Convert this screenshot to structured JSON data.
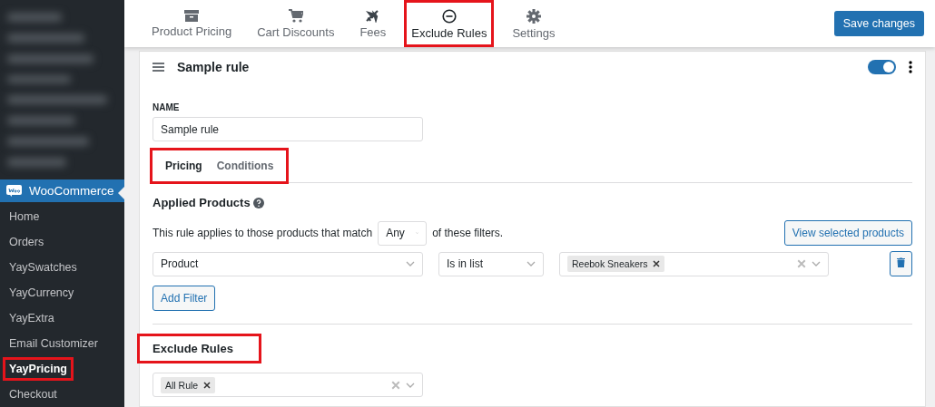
{
  "sidebar": {
    "section": {
      "label": "WooCommerce",
      "selected": true
    },
    "items": [
      {
        "label": "Home",
        "selected": false,
        "highlighted": false
      },
      {
        "label": "Orders",
        "selected": false,
        "highlighted": false
      },
      {
        "label": "YaySwatches",
        "selected": false,
        "highlighted": false
      },
      {
        "label": "YayCurrency",
        "selected": false,
        "highlighted": false
      },
      {
        "label": "YayExtra",
        "selected": false,
        "highlighted": false
      },
      {
        "label": "Email Customizer",
        "selected": false,
        "highlighted": false
      },
      {
        "label": "YayPricing",
        "selected": true,
        "highlighted": true
      },
      {
        "label": "Checkout",
        "selected": false,
        "highlighted": false
      }
    ]
  },
  "top_tabs": [
    {
      "kind": "box",
      "label": "Product Pricing",
      "selected": false,
      "highlighted": false
    },
    {
      "kind": "cart",
      "label": "Cart Discounts",
      "selected": false,
      "highlighted": false
    },
    {
      "kind": "plane",
      "label": "Fees",
      "selected": false,
      "highlighted": false
    },
    {
      "kind": "minus",
      "label": "Exclude Rules",
      "selected": true,
      "highlighted": true
    },
    {
      "kind": "gear",
      "label": "Settings",
      "selected": false,
      "highlighted": false
    }
  ],
  "save_button": "Save changes",
  "rule": {
    "title": "Sample rule",
    "on": true,
    "name_label": "NAME",
    "name_value": "Sample rule",
    "tabs": {
      "highlighted": true,
      "items": [
        {
          "label": "Pricing",
          "selected": true
        },
        {
          "label": "Conditions",
          "selected": false
        }
      ]
    },
    "applied_products": {
      "title": "Applied Products",
      "match_prefix": "This rule applies to those products that match",
      "match_value": "Any",
      "match_suffix": "of these filters.",
      "view_button": "View selected products",
      "filter": {
        "field": "Product",
        "operator": "Is in list",
        "tags": [
          "Reebok Sneakers"
        ]
      },
      "add_filter": "Add Filter"
    },
    "exclude": {
      "title": "Exclude Rules",
      "highlighted": true,
      "tags": [
        "All Rule"
      ]
    }
  }
}
